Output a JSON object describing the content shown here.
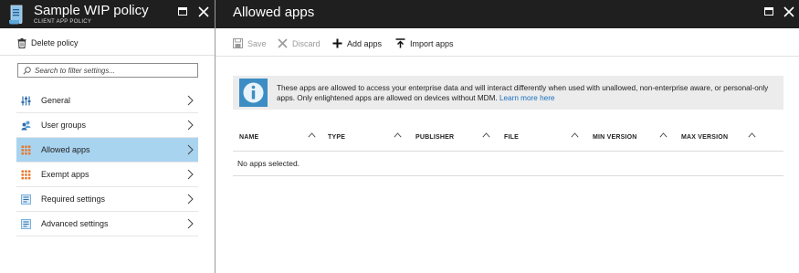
{
  "left_blade": {
    "title": "Sample WIP policy",
    "subtitle": "CLIENT APP POLICY",
    "delete_label": "Delete policy",
    "filter_placeholder": "Search to filter settings...",
    "nav": [
      {
        "label": "General",
        "icon": "sliders-icon"
      },
      {
        "label": "User groups",
        "icon": "users-icon"
      },
      {
        "label": "Allowed apps",
        "icon": "apps-grid-icon",
        "active": true
      },
      {
        "label": "Exempt apps",
        "icon": "apps-grid-icon"
      },
      {
        "label": "Required settings",
        "icon": "settings-doc-icon"
      },
      {
        "label": "Advanced settings",
        "icon": "settings-doc-icon"
      }
    ]
  },
  "right_blade": {
    "title": "Allowed apps",
    "toolbar": {
      "save": "Save",
      "discard": "Discard",
      "add_apps": "Add apps",
      "import_apps": "Import apps"
    },
    "info": {
      "text": "These apps are allowed to access your enterprise data and will interact differently when used with unallowed, non-enterprise aware, or personal-only apps. Only enlightened apps are allowed on devices without MDM.",
      "link": "Learn more here"
    },
    "table": {
      "columns": [
        "NAME",
        "TYPE",
        "PUBLISHER",
        "FILE",
        "MIN VERSION",
        "MAX VERSION"
      ],
      "empty_message": "No apps selected."
    }
  },
  "colors": {
    "header_bg": "#1f1f1f",
    "active_nav": "#a9d4f0",
    "info_bg": "#ececec",
    "link": "#1a6fbf",
    "info_icon": "#3c8dc4"
  }
}
